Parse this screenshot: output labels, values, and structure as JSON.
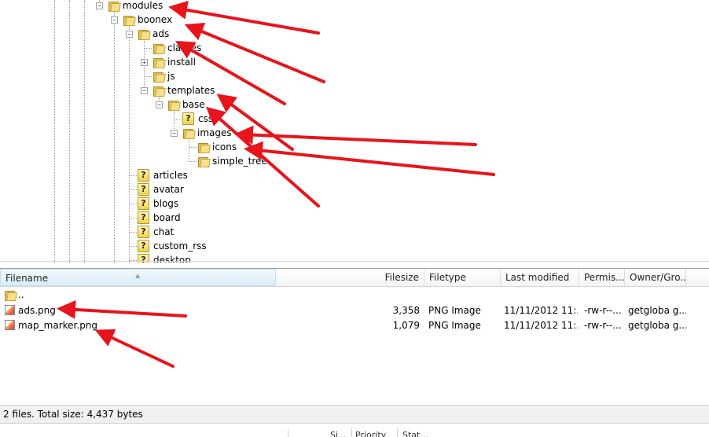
{
  "tree": {
    "nodes": {
      "modules": "modules",
      "boonex": "boonex",
      "ads": "ads",
      "classes": "classes",
      "install": "install",
      "js": "js",
      "templates": "templates",
      "base": "base",
      "css": "css",
      "images": "images",
      "icons": "icons",
      "simple_tree": "simple_tree",
      "articles": "articles",
      "avatar": "avatar",
      "blogs": "blogs",
      "board": "board",
      "chat": "chat",
      "custom_rss": "custom_rss",
      "desktop": "desktop"
    },
    "expander_collapsed": "+",
    "expander_expanded": "−"
  },
  "filelist": {
    "columns": {
      "filename": "Filename",
      "filesize": "Filesize",
      "filetype": "Filetype",
      "last_modified": "Last modified",
      "permissions": "Permis...",
      "owner_group": "Owner/Gro..."
    },
    "sorted_by": "Filename",
    "parent_entry": "..",
    "rows": [
      {
        "name": "ads.png",
        "size": "3,358",
        "type": "PNG Image",
        "modified": "11/11/2012 11:...",
        "perms": "-rw-r--...",
        "owner": "getgloba g..."
      },
      {
        "name": "map_marker.png",
        "size": "1,079",
        "type": "PNG Image",
        "modified": "11/11/2012 11:...",
        "perms": "-rw-r--...",
        "owner": "getgloba g..."
      }
    ]
  },
  "status": {
    "summary": "2 files. Total size: 4,437 bytes"
  },
  "queue": {
    "col_size": "Si...",
    "col_priority": "Priority",
    "col_status": "Stat..."
  },
  "annotation": {
    "arrow_color": "#e8141b"
  },
  "colors": {
    "folder": "#f7e08a",
    "header_sorted": "#d9ecf8"
  }
}
